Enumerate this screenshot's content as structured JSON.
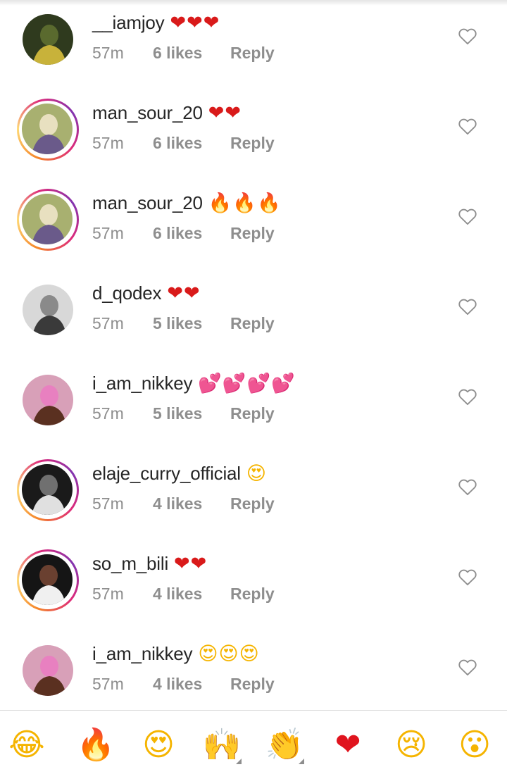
{
  "comments": [
    {
      "username": "__iamjoy",
      "emoji": "❤❤❤",
      "emoji_style": "hearts",
      "time": "57m",
      "likes": "6 likes",
      "reply": "Reply",
      "story_ring": false,
      "avatar_colors": [
        "#2f3a1e",
        "#c8b23a",
        "#5a6a2e"
      ]
    },
    {
      "username": "man_sour_20",
      "emoji": "❤❤",
      "emoji_style": "hearts",
      "time": "57m",
      "likes": "6 likes",
      "reply": "Reply",
      "story_ring": true,
      "avatar_colors": [
        "#a8b070",
        "#6a5a8a",
        "#e8e0c0"
      ]
    },
    {
      "username": "man_sour_20",
      "emoji": "🔥🔥🔥",
      "emoji_style": "fire",
      "time": "57m",
      "likes": "6 likes",
      "reply": "Reply",
      "story_ring": true,
      "avatar_colors": [
        "#a8b070",
        "#6a5a8a",
        "#e8e0c0"
      ]
    },
    {
      "username": "d_qodex",
      "emoji": "❤❤",
      "emoji_style": "hearts",
      "time": "57m",
      "likes": "5 likes",
      "reply": "Reply",
      "story_ring": false,
      "avatar_colors": [
        "#d8d8d8",
        "#3a3a3a",
        "#8a8a8a"
      ]
    },
    {
      "username": "i_am_nikkey",
      "emoji": "💕💕💕💕",
      "emoji_style": "hearts2",
      "time": "57m",
      "likes": "5 likes",
      "reply": "Reply",
      "story_ring": false,
      "avatar_colors": [
        "#d8a0b8",
        "#5a3020",
        "#e880c0"
      ]
    },
    {
      "username": "elaje_curry_official",
      "emoji": "😍",
      "emoji_style": "face",
      "time": "57m",
      "likes": "4 likes",
      "reply": "Reply",
      "story_ring": true,
      "avatar_colors": [
        "#1a1a1a",
        "#e0e0e0",
        "#707070"
      ]
    },
    {
      "username": "so_m_bili",
      "emoji": "❤❤",
      "emoji_style": "hearts",
      "time": "57m",
      "likes": "4 likes",
      "reply": "Reply",
      "story_ring": true,
      "avatar_colors": [
        "#151515",
        "#f0f0f0",
        "#6a4030"
      ]
    },
    {
      "username": "i_am_nikkey",
      "emoji": "😍😍😍",
      "emoji_style": "face",
      "time": "57m",
      "likes": "4 likes",
      "reply": "Reply",
      "story_ring": false,
      "avatar_colors": [
        "#d8a0b8",
        "#5a3020",
        "#e880c0"
      ]
    }
  ],
  "emoji_bar": [
    {
      "name": "joy-emoji",
      "glyph": "😂",
      "color": "#f5b400",
      "has_variants": false
    },
    {
      "name": "fire-emoji",
      "glyph": "🔥",
      "color": "#f57c00",
      "has_variants": false
    },
    {
      "name": "heart-eyes-emoji",
      "glyph": "😍",
      "color": "#f5b400",
      "has_variants": false
    },
    {
      "name": "raised-hands-emoji",
      "glyph": "🙌",
      "color": "#f5b400",
      "has_variants": true
    },
    {
      "name": "clap-emoji",
      "glyph": "👏",
      "color": "#f5b400",
      "has_variants": true
    },
    {
      "name": "red-heart-emoji",
      "glyph": "❤",
      "color": "#e0141e",
      "has_variants": false
    },
    {
      "name": "crying-face-emoji",
      "glyph": "😢",
      "color": "#f5b400",
      "has_variants": false
    },
    {
      "name": "drooling-face-emoji",
      "glyph": "😮",
      "color": "#f5b400",
      "has_variants": false
    }
  ],
  "colors": {
    "text_primary": "#262626",
    "text_secondary": "#8e8e8e",
    "divider": "#dbdbdb"
  }
}
